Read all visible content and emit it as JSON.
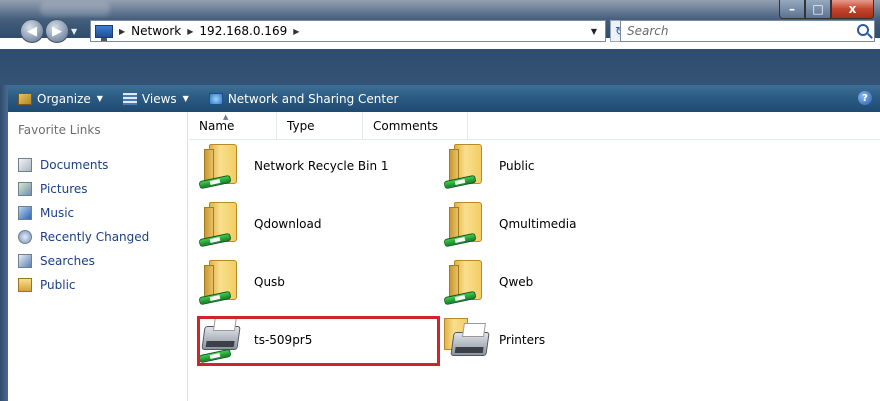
{
  "window": {
    "buttons": {
      "minimize": "–",
      "maximize": "□",
      "close": "x"
    }
  },
  "address": {
    "crumbs": [
      "Network",
      "192.168.0.169"
    ],
    "search_placeholder": "Search"
  },
  "toolbar": {
    "organize": "Organize",
    "views": "Views",
    "network_center": "Network and Sharing Center",
    "help": "?"
  },
  "sidebar": {
    "heading": "Favorite Links",
    "items": [
      {
        "label": "Documents",
        "icon": "documents-icon"
      },
      {
        "label": "Pictures",
        "icon": "pictures-icon"
      },
      {
        "label": "Music",
        "icon": "music-icon"
      },
      {
        "label": "Recently Changed",
        "icon": "recently-changed-icon"
      },
      {
        "label": "Searches",
        "icon": "searches-icon"
      },
      {
        "label": "Public",
        "icon": "folder-icon"
      }
    ]
  },
  "columns": [
    "Name",
    "Type",
    "Comments"
  ],
  "items": [
    {
      "label": "Network Recycle Bin 1",
      "icon": "shared-folder-icon"
    },
    {
      "label": "Public",
      "icon": "shared-folder-icon"
    },
    {
      "label": "Qdownload",
      "icon": "shared-folder-icon"
    },
    {
      "label": "Qmultimedia",
      "icon": "shared-folder-icon"
    },
    {
      "label": "Qusb",
      "icon": "shared-folder-icon"
    },
    {
      "label": "Qweb",
      "icon": "shared-folder-icon"
    },
    {
      "label": "ts-509pr5",
      "icon": "shared-printer-icon"
    },
    {
      "label": "Printers",
      "icon": "printers-folder-icon"
    }
  ],
  "colors": {
    "highlight_border": "#d2232a",
    "link_text": "#1a3f88",
    "toolbar_bg": "#2a5a82"
  }
}
